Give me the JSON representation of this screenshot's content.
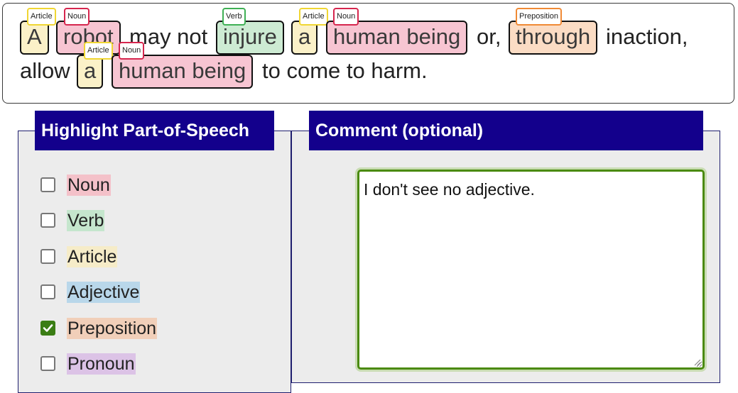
{
  "sentence": {
    "tokens": {
      "A": "A",
      "robot": "robot",
      "may_not": "may not",
      "injure": "injure",
      "a1": "a",
      "human_being1": "human being",
      "or": "or,",
      "through": "through",
      "inaction": "inaction,",
      "allow": "allow",
      "a2": "a",
      "human_being2": "human being",
      "to_come_to_harm": "to come to harm."
    },
    "tags": {
      "article": "Article",
      "noun": "Noun",
      "verb": "Verb",
      "preposition": "Preposition"
    }
  },
  "pos_panel": {
    "title": "Highlight Part-of-Speech",
    "options": [
      {
        "label": "Noun",
        "checked": false,
        "color": "#f4c1c9"
      },
      {
        "label": "Verb",
        "checked": false,
        "color": "#c5e6cd"
      },
      {
        "label": "Article",
        "checked": false,
        "color": "#f6ecc8"
      },
      {
        "label": "Adjective",
        "checked": false,
        "color": "#b9d7ea"
      },
      {
        "label": "Preposition",
        "checked": true,
        "color": "#f1cfb9"
      },
      {
        "label": "Pronoun",
        "checked": false,
        "color": "#dcc3e6"
      }
    ]
  },
  "comment_panel": {
    "title": "Comment (optional)",
    "value": "I don't see no adjective."
  },
  "colors": {
    "legend_bg": "#13008c",
    "accent_green": "#4a8a0e"
  }
}
